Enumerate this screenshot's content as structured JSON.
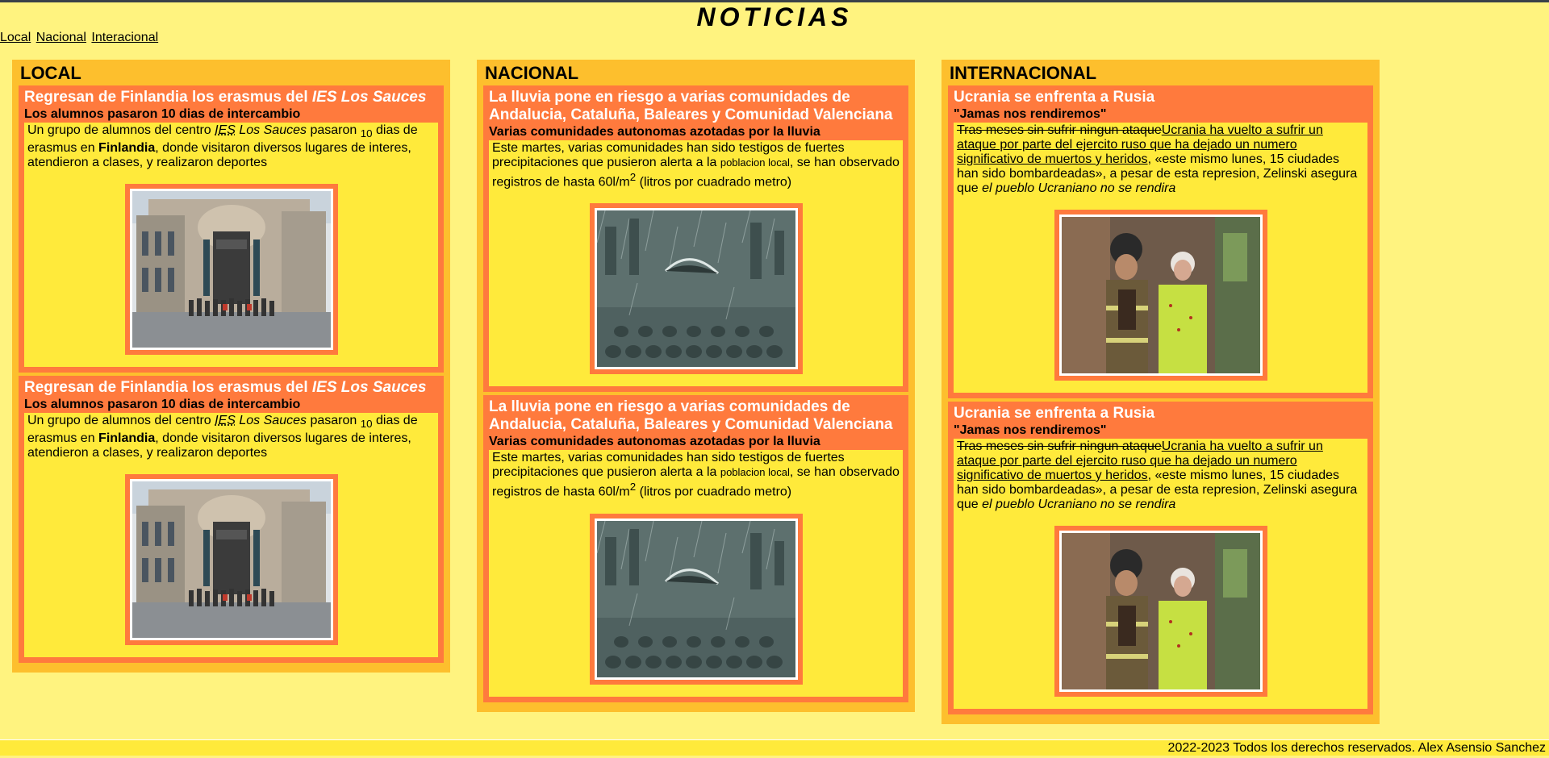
{
  "header": {
    "title": "NOTICIAS"
  },
  "nav": {
    "local": "Local",
    "nacional": "Nacional",
    "internacional": "Interacional"
  },
  "sections": {
    "local": {
      "title": "LOCAL",
      "article": {
        "headline_a": "Regresan de Finlandia los erasmus del ",
        "headline_b": "IES Los Sauces",
        "subtitle": "Los alumnos pasaron 10 dias de intercambio",
        "p1": "Un grupo de alumnos del centro ",
        "ies": "IES",
        "los_sauces": " Los Sauces",
        "p2": " pasaron ",
        "num": "10",
        "p3": " dias de erasmus en ",
        "finlandia": "Finlandia",
        "p4": ", donde visitaron diversos lugares de interes, atendieron a clases, y realizaron deportes",
        "image": "building-group-photo"
      }
    },
    "nacional": {
      "title": "NACIONAL",
      "article": {
        "headline": "La lluvia pone en riesgo a varias comunidades de Andalucia, Cataluña, Baleares y Comunidad Valenciana",
        "subtitle": "Varias comunidades autonomas azotadas por la lluvia",
        "p1": "Este martes, varias comunidades han sido testigos de fuertes precipitaciones que pusieron alerta a la ",
        "small": "poblacion local",
        "p2": ", se han observado registros de hasta 60l/m",
        "sup": "2",
        "p3": " (litros por cuadrado metro)",
        "image": "rain-umbrella-photo"
      }
    },
    "internacional": {
      "title": "INTERNACIONAL",
      "article": {
        "headline": "Ucrania se enfrenta a Rusia",
        "subtitle": "\"Jamas nos rendiremos\"",
        "strike": "Tras meses sin sufrir ningun ataque",
        "link": "Ucrania ha vuelto a sufrir un ataque por parte del ejercito ruso que ha dejado un numero significativo de muertos y heridos",
        "p1": ", «este mismo lunes, 15 ciudades han sido bombardeadas», a pesar de esta represion, Zelinski asegura que ",
        "em": "el pueblo Ucraniano no se rendira",
        "image": "firefighter-injured-woman-photo"
      }
    }
  },
  "footer": {
    "text": "2022-2023 Todos los derechos reservados. Alex Asensio Sanchez"
  }
}
